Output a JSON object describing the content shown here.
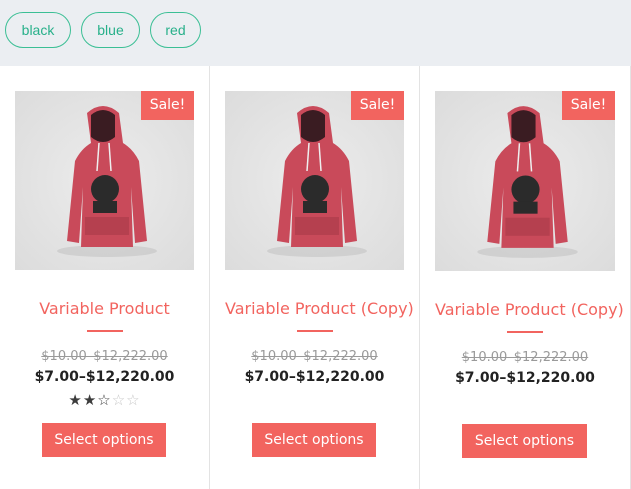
{
  "filters": [
    {
      "label": "black"
    },
    {
      "label": "blue"
    },
    {
      "label": "red"
    }
  ],
  "products": [
    {
      "sale_badge": "Sale!",
      "title": "Variable Product",
      "old_price": "$10.00–$12,222.00",
      "price": "$7.00–$12,220.00",
      "rating": 2.5,
      "button": "Select options"
    },
    {
      "sale_badge": "Sale!",
      "title": "Variable Product (Copy)",
      "old_price": "$10.00–$12,222.00",
      "price": "$7.00–$12,220.00",
      "button": "Select options"
    },
    {
      "sale_badge": "Sale!",
      "title": "Variable Product (Copy)",
      "old_price": "$10.00–$12,222.00",
      "price": "$7.00–$12,220.00",
      "button": "Select options"
    }
  ],
  "colors": {
    "accent": "#f2645f",
    "chip_border": "#3bbf95",
    "hoodie": "#c94a5a"
  },
  "icons": [
    "hoodie-image",
    "star-icon"
  ]
}
